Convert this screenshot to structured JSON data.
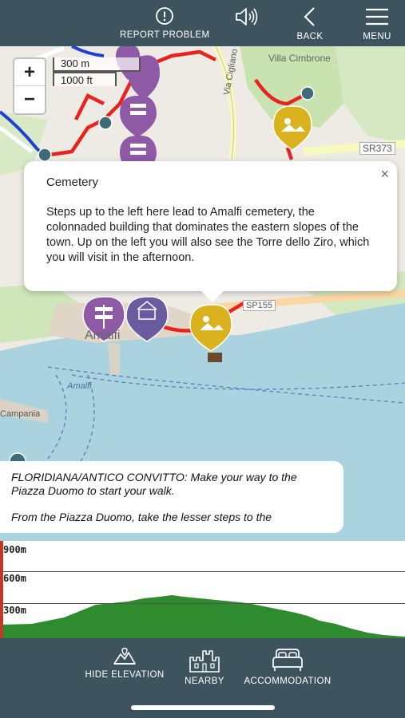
{
  "toolbar": {
    "report_label": "REPORT PROBLEM",
    "back_label": "BACK",
    "menu_label": "MENU",
    "sound_icon": "speaker-icon"
  },
  "map": {
    "zoom_in": "+",
    "zoom_out": "−",
    "scale_metric": "300 m",
    "scale_imperial": "1000 ft",
    "labels": {
      "villa": "Villa Cimbrone",
      "via": "Via Cigliano",
      "sr373": "SR373",
      "sp155": "SP155",
      "amalfi_town": "Amalfi",
      "amalfi_sea": "Amalfi",
      "campania": "Campania"
    }
  },
  "popup": {
    "title": "Cemetery",
    "body": "Steps up to the left here lead to Amalfi cemetery, the colonnaded building that dominates the eastern slopes of the town. Up on the left you will also see the Torre dello Ziro, which you will visit in the afternoon.",
    "close": "×"
  },
  "directions": {
    "p1": "FLORIDIANA/ANTICO CONVITTO: Make your way to the Piazza Duomo to start your walk.",
    "p2": "From the Piazza Duomo, take the lesser steps to the"
  },
  "elevation": {
    "gridlines": [
      "900m",
      "600m",
      "300m"
    ]
  },
  "bottombar": {
    "hide_elevation": "HIDE ELEVATION",
    "nearby": "NEARBY",
    "accommodation": "ACCOMMODATION"
  },
  "colors": {
    "bar": "#3d535d",
    "route": "#e8231f",
    "poi_purple": "#8e5aa6",
    "poi_yellow": "#d9b21e",
    "sea": "#aad3df",
    "elevation": "#2e8b2e"
  }
}
